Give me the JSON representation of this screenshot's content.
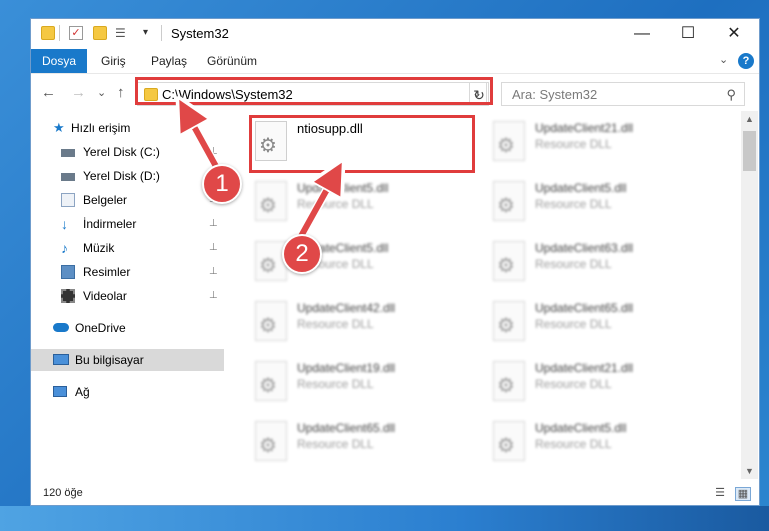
{
  "window": {
    "title": "System32",
    "minimize_glyph": "—",
    "maximize_glyph": "☐",
    "close_glyph": "✕"
  },
  "ribbon": {
    "tabs": [
      "Dosya",
      "Giriş",
      "Paylaş",
      "Görünüm"
    ],
    "collapse_glyph": "⌄",
    "help_glyph": "?"
  },
  "navigation": {
    "back_glyph": "←",
    "forward_glyph": "→",
    "recent_glyph": "⌄",
    "up_glyph": "↑",
    "address": "C:\\Windows\\System32",
    "address_dropdown_glyph": "⌄",
    "refresh_glyph": "↻",
    "search_placeholder": "Ara: System32",
    "search_glyph": "⚲"
  },
  "sidebar": {
    "items": [
      {
        "label": "Hızlı erişim",
        "icon": "star-icon",
        "pinned": false
      },
      {
        "label": "Yerel Disk (C:)",
        "icon": "drive-icon",
        "pinned": true
      },
      {
        "label": "Yerel Disk (D:)",
        "icon": "drive-icon",
        "pinned": true
      },
      {
        "label": "Belgeler",
        "icon": "documents-icon",
        "pinned": true
      },
      {
        "label": "İndirmeler",
        "icon": "download-icon",
        "pinned": true
      },
      {
        "label": "Müzik",
        "icon": "music-icon",
        "pinned": true
      },
      {
        "label": "Resimler",
        "icon": "pictures-icon",
        "pinned": true
      },
      {
        "label": "Videolar",
        "icon": "videos-icon",
        "pinned": true
      },
      {
        "label": "OneDrive",
        "icon": "cloud-icon",
        "pinned": false
      },
      {
        "label": "Bu bilgisayar",
        "icon": "computer-icon",
        "pinned": false,
        "selected": true
      },
      {
        "label": "Ağ",
        "icon": "network-icon",
        "pinned": false
      }
    ],
    "pin_glyph": "📌"
  },
  "files": [
    {
      "name": "ntiosupp.dll",
      "type": "",
      "blurred": false
    },
    {
      "name": "UpdateClient21.dll",
      "type": "Resource DLL",
      "blurred": true
    },
    {
      "name": "UpdateClient5.dll",
      "type": "Resource DLL",
      "blurred": true
    },
    {
      "name": "UpdateClient5.dll",
      "type": "Resource DLL",
      "blurred": true
    },
    {
      "name": "UpdateClient5.dll",
      "type": "Resource DLL",
      "blurred": true
    },
    {
      "name": "UpdateClient63.dll",
      "type": "Resource DLL",
      "blurred": true
    },
    {
      "name": "UpdateClient42.dll",
      "type": "Resource DLL",
      "blurred": true
    },
    {
      "name": "UpdateClient65.dll",
      "type": "Resource DLL",
      "blurred": true
    },
    {
      "name": "UpdateClient19.dll",
      "type": "Resource DLL",
      "blurred": true
    },
    {
      "name": "UpdateClient21.dll",
      "type": "Resource DLL",
      "blurred": true
    },
    {
      "name": "UpdateClient65.dll",
      "type": "Resource DLL",
      "blurred": true
    },
    {
      "name": "UpdateClient5.dll",
      "type": "Resource DLL",
      "blurred": true
    }
  ],
  "status": {
    "item_count": "120 öğe"
  },
  "callouts": [
    "1",
    "2"
  ],
  "colors": {
    "accent": "#1979ca",
    "highlight": "#e03c3c",
    "callout": "#e04848"
  }
}
